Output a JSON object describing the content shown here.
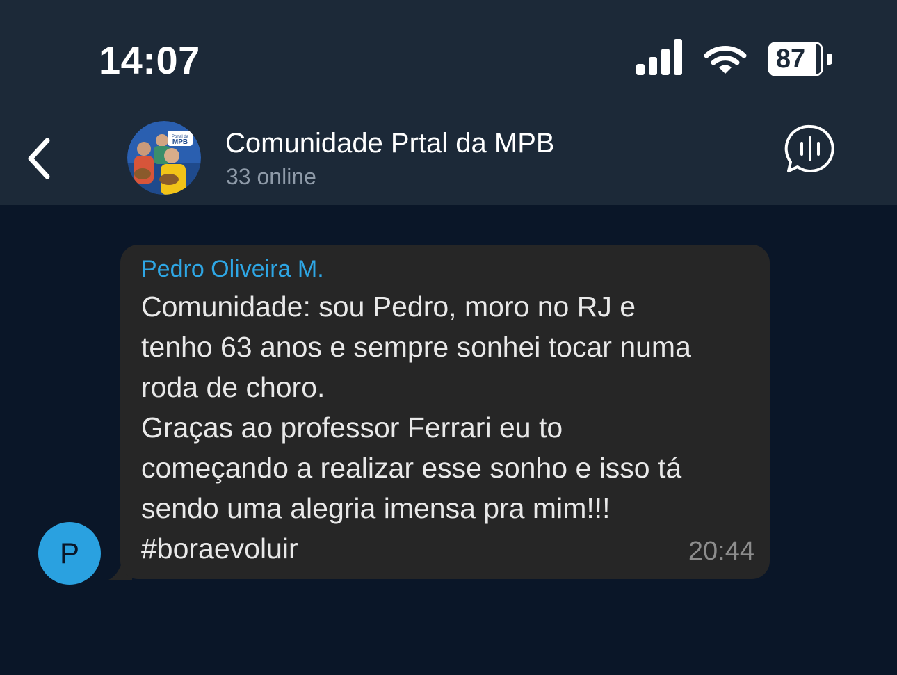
{
  "status_bar": {
    "time": "14:07",
    "battery_level": "87",
    "signal_icon": "cellular-signal-icon",
    "wifi_icon": "wifi-icon"
  },
  "header": {
    "back_icon": "chevron-left-icon",
    "title": "Comunidade Prtal da MPB",
    "subtitle": "33 online",
    "avatar_logo_text": "Portal da MPB",
    "voice_chat_icon": "voice-chat-icon"
  },
  "message": {
    "sender_name": "Pedro Oliveira M.",
    "sender_initial": "P",
    "lines": [
      "Comunidade: sou Pedro, moro no RJ e",
      "tenho 63 anos e sempre sonhei tocar numa",
      "roda de choro.",
      "Graças ao professor Ferrari eu to",
      "começando a realizar esse sonho e isso tá",
      "sendo uma alegria imensa pra mim!!!",
      "#boraevoluir"
    ],
    "time": "20:44"
  },
  "colors": {
    "header_bg": "#1c2938",
    "chat_bg": "#0a1628",
    "bubble_bg": "#262626",
    "sender_name": "#2ea6e4",
    "avatar_bg": "#2aa1e0"
  }
}
